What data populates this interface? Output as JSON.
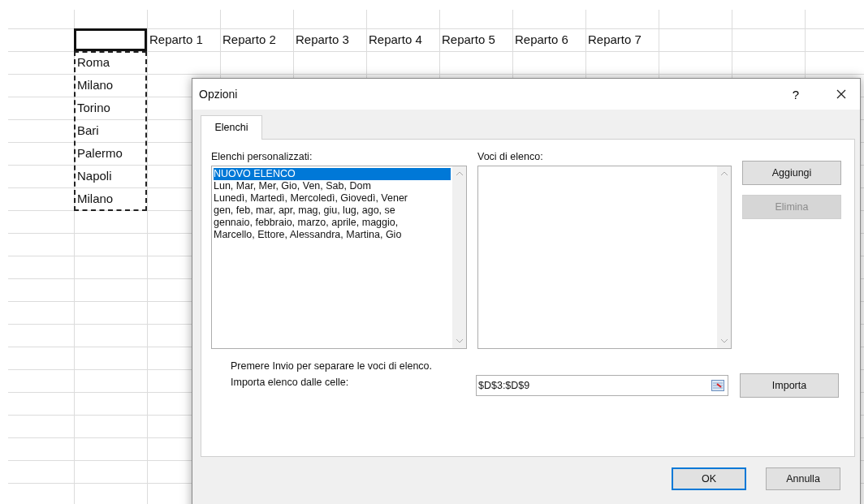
{
  "sheet": {
    "header_cells": [
      "Reparto 1",
      "Reparto 2",
      "Reparto 3",
      "Reparto 4",
      "Reparto 5",
      "Reparto 6",
      "Reparto 7"
    ],
    "column_cells": [
      "Roma",
      "Milano",
      "Torino",
      "Bari",
      "Palermo",
      "Napoli",
      "Milano"
    ]
  },
  "dialog": {
    "title": "Opzioni",
    "help": "?",
    "tabs": [
      {
        "label": "Elenchi",
        "selected": true
      }
    ],
    "custom_lists": {
      "label": "Elenchi personalizzati:",
      "items": [
        {
          "text": "NUOVO ELENCO",
          "selected": true
        },
        {
          "text": "Lun, Mar, Mer, Gio, Ven, Sab, Dom",
          "selected": false
        },
        {
          "text": "Lunedì, Martedì, Mercoledì, Giovedì, Vener",
          "selected": false
        },
        {
          "text": "gen, feb, mar, apr, mag, giu, lug, ago, se",
          "selected": false
        },
        {
          "text": "gennaio, febbraio, marzo, aprile, maggio,",
          "selected": false
        },
        {
          "text": "Marcello, Ettore, Alessandra, Martina, Gio",
          "selected": false
        }
      ]
    },
    "entries": {
      "label": "Voci di elenco:"
    },
    "side_buttons": [
      {
        "label": "Aggiungi",
        "disabled": false
      },
      {
        "label": "Elimina",
        "disabled": true
      }
    ],
    "hint": "Premere Invio per separare le voci di elenco.",
    "import": {
      "label": "Importa elenco dalle celle:",
      "value": "$D$3:$D$9",
      "button": "Importa"
    },
    "footer_buttons": [
      {
        "label": "OK",
        "default": true
      },
      {
        "label": "Annulla",
        "default": false
      }
    ]
  }
}
